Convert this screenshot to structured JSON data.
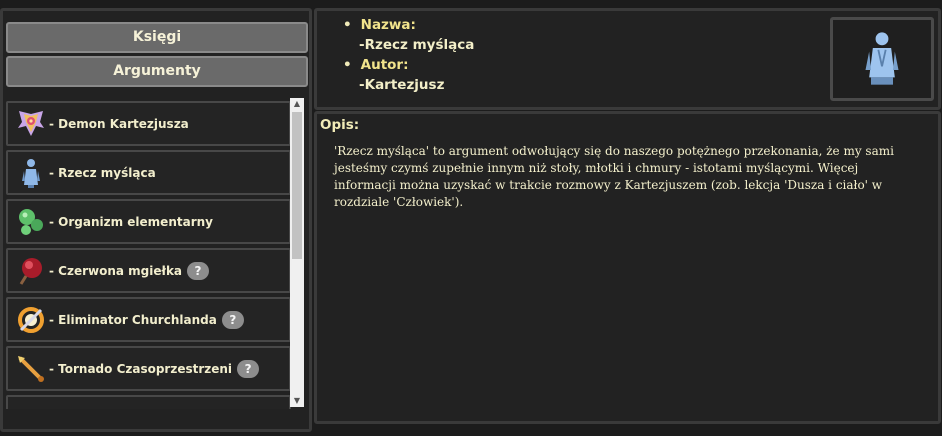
{
  "tabs": {
    "books": "Księgi",
    "arguments": "Argumenty"
  },
  "list": [
    {
      "label": "- Demon Kartezjusza",
      "icon": "demon-icon",
      "unknown": false
    },
    {
      "label": "- Rzecz myśląca",
      "icon": "thinking-thing-icon",
      "unknown": false
    },
    {
      "label": "- Organizm elementarny",
      "icon": "organism-icon",
      "unknown": false
    },
    {
      "label": "- Czerwona mgiełka",
      "icon": "red-mist-icon",
      "unknown": true
    },
    {
      "label": "- Eliminator Churchlanda",
      "icon": "eliminator-icon",
      "unknown": true
    },
    {
      "label": "- Tornado Czasoprzestrzeni",
      "icon": "tornado-icon",
      "unknown": true
    }
  ],
  "question_mark": "?",
  "info": {
    "bullet": "•",
    "name_key": "Nazwa:",
    "name_value": "-Rzecz myśląca",
    "author_key": "Autor:",
    "author_value": "-Kartezjusz",
    "portrait_icon": "thinking-thing-portrait-icon"
  },
  "description": {
    "title": "Opis:",
    "text": "'Rzecz myśląca' to argument odwołujący się do naszego potężnego przekonania, że my sami jesteśmy czymś zupełnie innym niż stoły, młotki i chmury - istotami myślącymi. Więcej informacji można uzyskać w trakcie rozmowy z Kartezjuszem (zob. lekcja 'Dusza i ciało' w rozdziale 'Człowiek')."
  },
  "scroll_arrows": {
    "up": "▲",
    "down": "▼"
  }
}
